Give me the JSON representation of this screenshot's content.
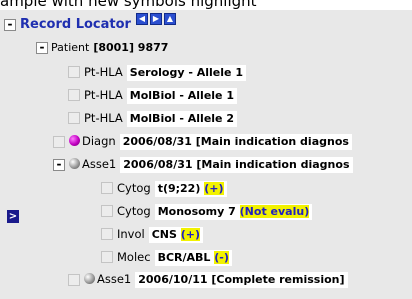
{
  "caption": {
    "before": "ample with new symbols highlight"
  },
  "tree": {
    "root_title": "Record Locator",
    "root_toggle": "-",
    "patient": {
      "toggle": "-",
      "label": "Patient",
      "id": "[8001] 9877"
    },
    "rows": [
      {
        "cat": "Pt-HLA",
        "value": "Serology - Allele 1"
      },
      {
        "cat": "Pt-HLA",
        "value": "MolBiol - Allele 1"
      },
      {
        "cat": "Pt-HLA",
        "value": "MolBiol - Allele 2"
      },
      {
        "cat": "Diagn",
        "value": "2006/08/31 [Main indication diagnos",
        "icon": "magenta-ball-icon"
      },
      {
        "cat": "Asse1",
        "value": "2006/08/31 [Main indication diagnos",
        "icon": "gray-ball-icon",
        "toggle": "-"
      },
      {
        "cat": "Cytog",
        "value": "t(9;22)",
        "flag": "(+)"
      },
      {
        "cat": "Cytog",
        "value": "Monosomy 7",
        "flag": "(Not evalu)"
      },
      {
        "cat": "Invol",
        "value": "CNS",
        "flag": "(+)"
      },
      {
        "cat": "Molec",
        "value": "BCR/ABL",
        "flag": "(-)"
      },
      {
        "cat": "Asse1",
        "value": "2006/10/11 [Complete remission]",
        "icon": "gray-ball-icon"
      }
    ],
    "pointer": ">"
  },
  "colors": {
    "title": "#1f2fb0",
    "highlight": "#f2f200",
    "panel": "#e8e8e8"
  }
}
